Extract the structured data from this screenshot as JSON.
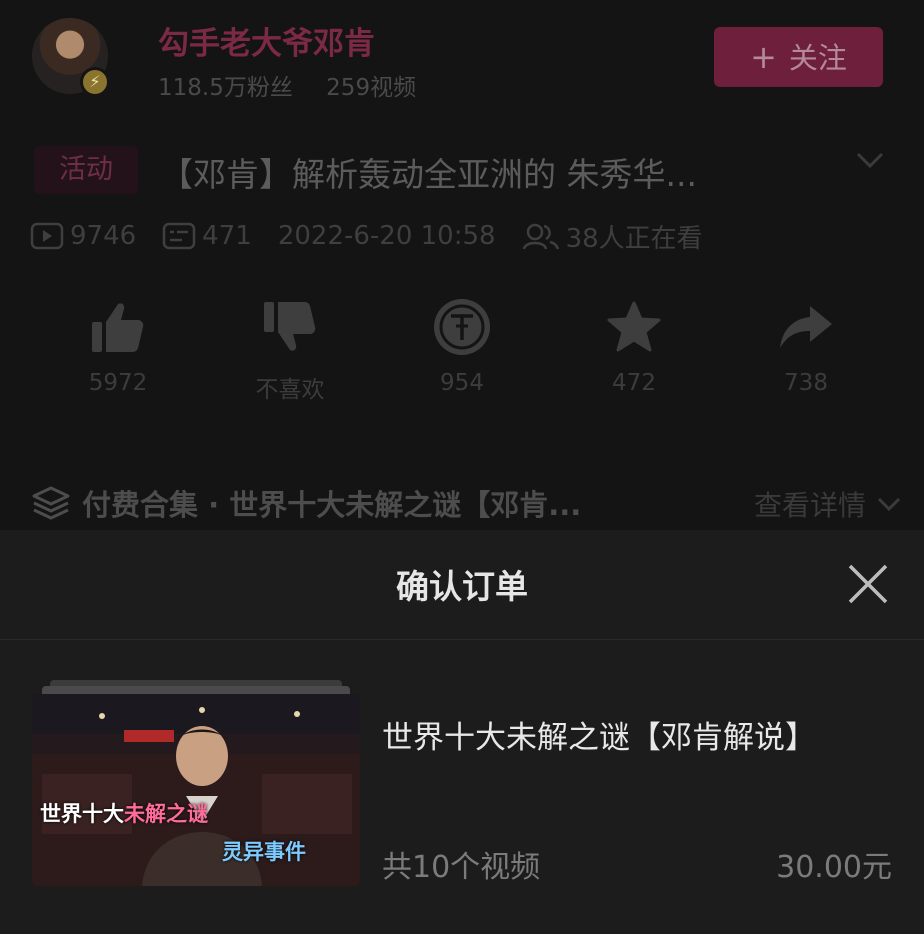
{
  "author": {
    "name": "勾手老大爷邓肯",
    "followers": "118.5万粉丝",
    "videos": "259视频",
    "follow_label": "关注",
    "follow_icon": "plus-icon",
    "badge_icon": "lightning-icon"
  },
  "video": {
    "tag": "活动",
    "title": "【邓肯】解析轰动全亚洲的 朱秀华...",
    "plays": "9746",
    "danmaku": "471",
    "datetime": "2022-6-20 10:58",
    "watching": "38人正在看"
  },
  "actions": [
    {
      "icon": "thumbs-up-icon",
      "label": "5972"
    },
    {
      "icon": "thumbs-down-icon",
      "label": "不喜欢"
    },
    {
      "icon": "coin-icon",
      "label": "954"
    },
    {
      "icon": "star-icon",
      "label": "472"
    },
    {
      "icon": "share-icon",
      "label": "738"
    }
  ],
  "collection": {
    "icon": "layers-icon",
    "title": "付费合集 · 世界十大未解之谜【邓肯...",
    "more_label": "查看详情"
  },
  "order_sheet": {
    "title": "确认订单",
    "close_icon": "close-icon",
    "cover_caption_white": "世界十大",
    "cover_caption_pink": "未解之谜",
    "cover_caption_blue": "灵异事件",
    "product_title": "世界十大未解之谜【邓肯解说】",
    "product_count": "共10个视频",
    "price": "30.00元"
  },
  "colors": {
    "brand_pink": "#6d1f3c",
    "background": "#121212",
    "sheet": "#1c1c1c"
  }
}
